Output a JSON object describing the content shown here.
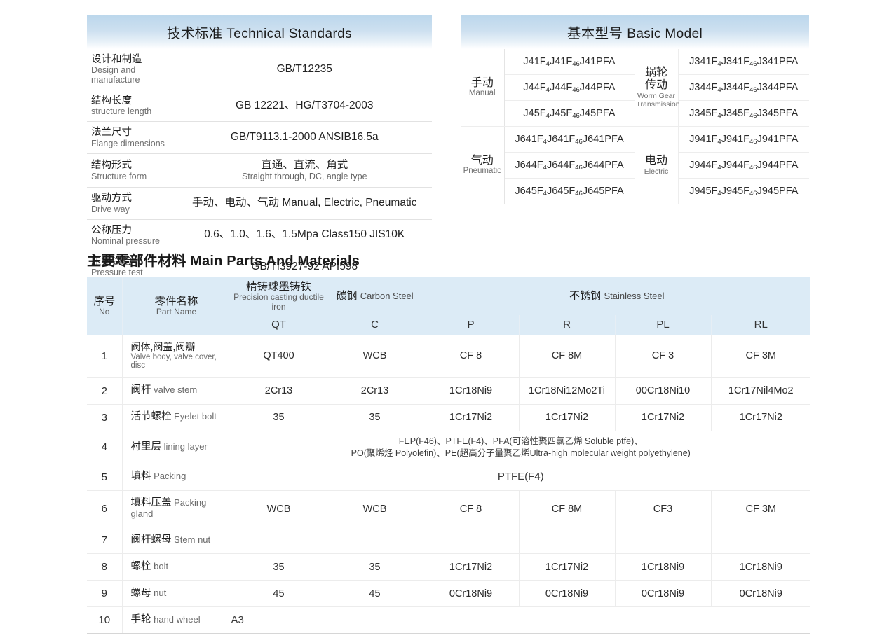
{
  "technical_standards": {
    "title_cn": "技术标准",
    "title_en": "Technical Standards",
    "rows": [
      {
        "label_cn": "设计和制造",
        "label_en": "Design and manufacture",
        "value": "GB/T12235",
        "value_sub": ""
      },
      {
        "label_cn": "结构长度",
        "label_en": "structure length",
        "value": "GB 12221、HG/T3704-2003",
        "value_sub": ""
      },
      {
        "label_cn": "法兰尺寸",
        "label_en": "Flange dimensions",
        "value": "GB/T9113.1-2000 ANSIB16.5a",
        "value_sub": ""
      },
      {
        "label_cn": "结构形式",
        "label_en": "Structure form",
        "value": "直通、直流、角式",
        "value_sub": "Straight through, DC, angle type"
      },
      {
        "label_cn": "驱动方式",
        "label_en": "Drive way",
        "value": "手动、电动、气动 Manual, Electric, Pneumatic",
        "value_sub": ""
      },
      {
        "label_cn": "公称压力",
        "label_en": "Nominal pressure",
        "value": "0.6、1.0、1.6、1.5Mpa  Class150  JIS10K",
        "value_sub": ""
      },
      {
        "label_cn": "压力试验",
        "label_en": "Pressure test",
        "value": "GB/TI3927-92 API598",
        "value_sub": ""
      }
    ]
  },
  "basic_model": {
    "title_cn": "基本型号",
    "title_en": "Basic Model",
    "groups": [
      {
        "left_drive_cn": "手动",
        "left_drive_en": "Manual",
        "right_drive_cn": "蜗轮传动",
        "right_drive_en": "Worm Gear Transmission",
        "right_drive_cn_line1": "蜗轮",
        "right_drive_cn_line2": "传动",
        "right_drive_en_line1": "Worm Gear",
        "right_drive_en_line2": "Transmission",
        "rows": [
          {
            "left": "J41F4J41F46J41PFA",
            "right": "J341F4J341F46J341PFA"
          },
          {
            "left": "J44F4J44F46J44PFA",
            "right": "J344F4J344F46J344PFA"
          },
          {
            "left": "J45F4J45F46J45PFA",
            "right": "J345F4J345F46J345PFA"
          }
        ]
      },
      {
        "left_drive_cn": "气动",
        "left_drive_en": "Pneumatic",
        "right_drive_cn": "电动",
        "right_drive_en": "Electric",
        "right_drive_cn_line1": "电动",
        "right_drive_cn_line2": "",
        "right_drive_en_line1": "Electric",
        "right_drive_en_line2": "",
        "rows": [
          {
            "left": "J641F4J641F46J641PFA",
            "right": "J941F4J941F46J941PFA"
          },
          {
            "left": "J644F4J644F46J644PFA",
            "right": "J944F4J944F46J944PFA"
          },
          {
            "left": "J645F4J645F46J645PFA",
            "right": "J945F4J945F46J945PFA"
          }
        ]
      }
    ]
  },
  "main_parts": {
    "title_cn": "主要零部件材料",
    "title_en": "Main Parts And Materials",
    "headers": {
      "no_cn": "序号",
      "no_en": "No",
      "name_cn": "零件名称",
      "name_en": "Part Name",
      "ductile_cn": "精铸球墨铸铁",
      "ductile_en": "Precision casting ductile iron",
      "ductile_code": "QT",
      "carbon_cn": "碳钢",
      "carbon_en": "Carbon Steel",
      "carbon_code": "C",
      "stainless_cn": "不锈钢",
      "stainless_en": "Stainless Steel",
      "stainless_codes": [
        "P",
        "R",
        "PL",
        "RL"
      ]
    },
    "rows": [
      {
        "no": "1",
        "name_cn": "阀体,阀盖,阀瓣",
        "name_en": "Valve body, valve cover, disc",
        "name_stacked": true,
        "cells": [
          "QT400",
          "WCB",
          "CF 8",
          "CF 8M",
          "CF 3",
          "CF 3M"
        ]
      },
      {
        "no": "2",
        "name_cn": "阀杆",
        "name_en": "valve stem",
        "name_stacked": false,
        "cells": [
          "2Cr13",
          "2Cr13",
          "1Cr18Ni9",
          "1Cr18Ni12Mo2Ti",
          "00Cr18Ni10",
          "1Cr17Nil4Mo2"
        ]
      },
      {
        "no": "3",
        "name_cn": "活节螺栓",
        "name_en": "Eyelet bolt",
        "name_stacked": false,
        "cells": [
          "35",
          "35",
          "1Cr17Ni2",
          "1Cr17Ni2",
          "1Cr17Ni2",
          "1Cr17Ni2"
        ]
      },
      {
        "no": "4",
        "name_cn": "衬里层",
        "name_en": "lining layer",
        "name_stacked": false,
        "span": true,
        "span_lines": [
          "FEP(F46)、PTFE(F4)、PFA(可溶性聚四氯乙烯 Soluble ptfe)、",
          "PO(聚烯烃 Polyolefin)、PE(超高分子量聚乙烯Ultra-high molecular weight polyethylene)"
        ]
      },
      {
        "no": "5",
        "name_cn": "填料",
        "name_en": "Packing",
        "name_stacked": false,
        "span": true,
        "span_lines": [
          "PTFE(F4)"
        ]
      },
      {
        "no": "6",
        "name_cn": "填料压盖",
        "name_en": "Packing gland",
        "name_stacked": false,
        "cells": [
          "WCB",
          "WCB",
          "CF 8",
          "CF 8M",
          "CF3",
          "CF 3M"
        ]
      },
      {
        "no": "7",
        "name_cn": "阀杆螺母",
        "name_en": "Stem nut",
        "name_stacked": false,
        "cells": [
          "",
          "",
          "",
          "",
          "",
          ""
        ]
      },
      {
        "no": "8",
        "name_cn": "螺栓",
        "name_en": "bolt",
        "name_stacked": false,
        "cells": [
          "35",
          "35",
          "1Cr17Ni2",
          "1Cr17Ni2",
          "1Cr18Ni9",
          "1Cr18Ni9"
        ]
      },
      {
        "no": "9",
        "name_cn": "螺母",
        "name_en": "nut",
        "name_stacked": false,
        "cells": [
          "45",
          "45",
          "0Cr18Ni9",
          "0Cr18Ni9",
          "0Cr18Ni9",
          "0Cr18Ni9"
        ]
      },
      {
        "no": "10",
        "name_cn": "手轮",
        "name_en": "hand wheel",
        "name_stacked": false,
        "span": true,
        "span_lines": [
          "A3"
        ]
      }
    ]
  },
  "colors": {
    "header_blue": "#bcd7ec",
    "table_header_blue": "#dcebf6",
    "text": "#2b2b2b",
    "muted": "#6f6f6f"
  }
}
